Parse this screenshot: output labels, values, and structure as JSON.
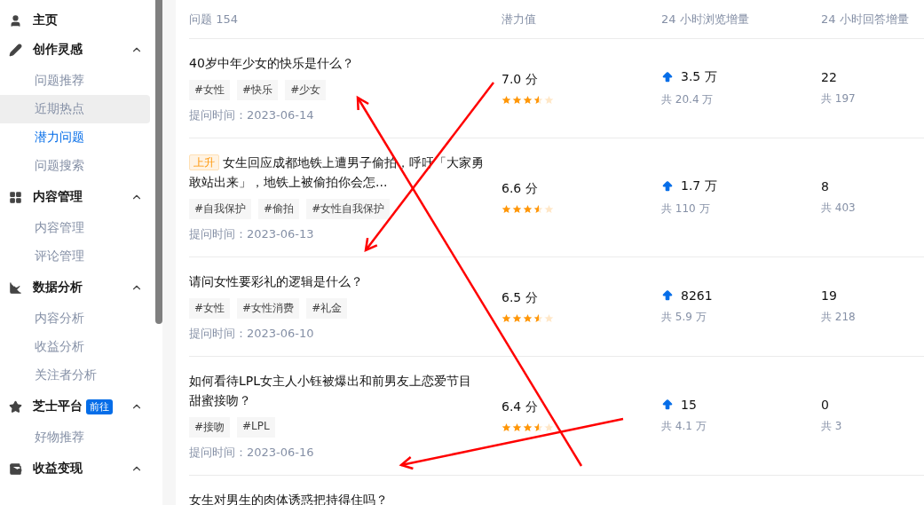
{
  "sidebar": {
    "sections": [
      {
        "label": "主页"
      },
      {
        "label": "创作灵感",
        "expanded": true,
        "children": [
          {
            "label": "问题推荐",
            "selected": false,
            "hovered": false
          },
          {
            "label": "近期热点",
            "selected": false,
            "hovered": true
          },
          {
            "label": "潜力问题",
            "selected": true,
            "hovered": false
          },
          {
            "label": "问题搜索",
            "selected": false,
            "hovered": false
          }
        ]
      },
      {
        "label": "内容管理",
        "expanded": true,
        "children": [
          {
            "label": "内容管理",
            "selected": false,
            "hovered": false
          },
          {
            "label": "评论管理",
            "selected": false,
            "hovered": false
          }
        ]
      },
      {
        "label": "数据分析",
        "expanded": true,
        "children": [
          {
            "label": "内容分析",
            "selected": false,
            "hovered": false
          },
          {
            "label": "收益分析",
            "selected": false,
            "hovered": false
          },
          {
            "label": "关注者分析",
            "selected": false,
            "hovered": false
          }
        ]
      },
      {
        "label": "芝士平台",
        "badge": "前往",
        "expanded": true,
        "children": [
          {
            "label": "好物推荐",
            "selected": false,
            "hovered": false
          }
        ]
      },
      {
        "label": "收益变现",
        "expanded": true
      }
    ]
  },
  "table": {
    "columns": [
      "问题 154",
      "潜力值",
      "24 小时浏览增量",
      "24 小时回答增量"
    ],
    "rows": [
      {
        "title": "40岁中年少女的快乐是什么？",
        "tags": [
          "#女性",
          "#快乐",
          "#少女"
        ],
        "date": "提问时间：2023-06-14",
        "score": "7.0 分",
        "stars": 3.5,
        "views": "3.5 万",
        "views_total": "共 20.4 万",
        "answers": "22",
        "answers_total": "共 197"
      },
      {
        "badge": "上升",
        "title": "女生回应成都地铁上遭男子偷拍，呼吁「大家勇敢站出来」，地铁上被偷拍你会怎...",
        "tags": [
          "#自我保护",
          "#偷拍",
          "#女性自我保护"
        ],
        "date": "提问时间：2023-06-13",
        "score": "6.6 分",
        "stars": 3.5,
        "views": "1.7 万",
        "views_total": "共 110 万",
        "answers": "8",
        "answers_total": "共 403"
      },
      {
        "title": "请问女性要彩礼的逻辑是什么？",
        "tags": [
          "#女性",
          "#女性消费",
          "#礼金"
        ],
        "date": "提问时间：2023-06-10",
        "score": "6.5 分",
        "stars": 3.5,
        "views": "8261",
        "views_total": "共 5.9 万",
        "answers": "19",
        "answers_total": "共 218"
      },
      {
        "title": "如何看待LPL女主人小钰被爆出和前男友上恋爱节目甜蜜接吻？",
        "tags": [
          "#接吻",
          "#LPL"
        ],
        "date": "提问时间：2023-06-16",
        "score": "6.4 分",
        "stars": 3.5,
        "views": "15",
        "views_total": "共 4.1 万",
        "answers": "0",
        "answers_total": "共 3"
      },
      {
        "title": "女生对男生的肉体诱惑把持得住吗？"
      }
    ]
  }
}
